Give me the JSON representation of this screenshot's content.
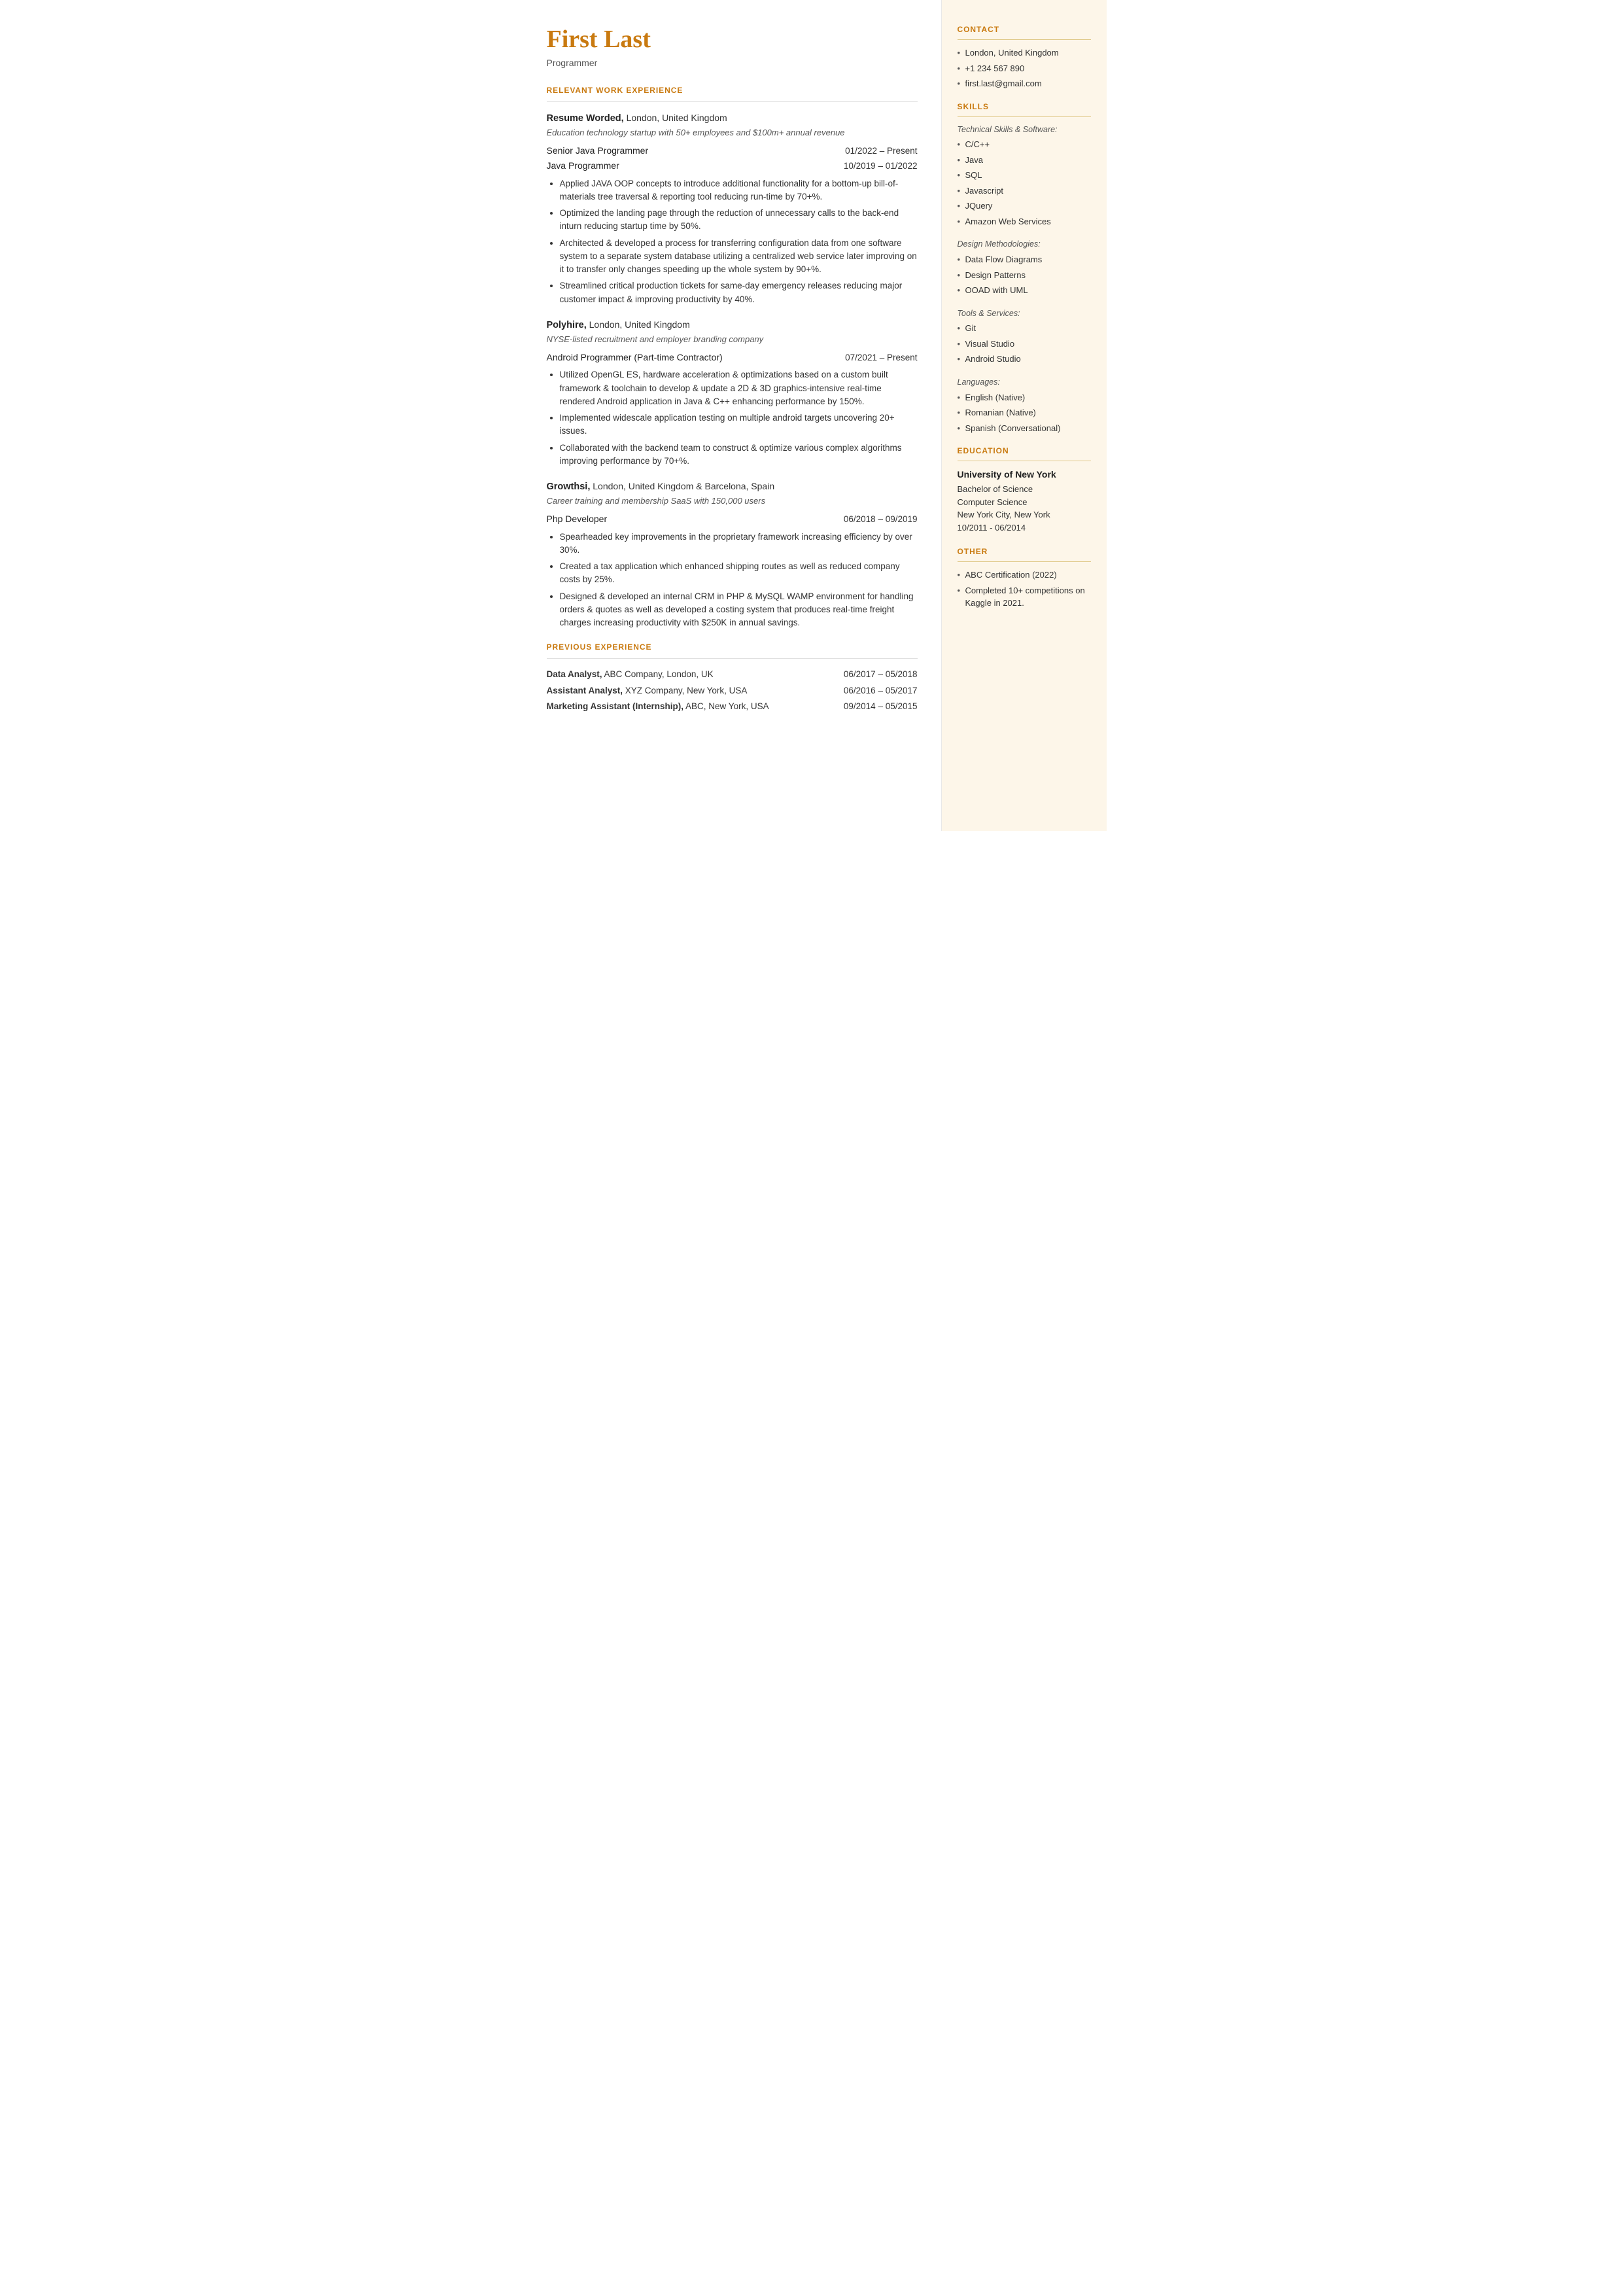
{
  "header": {
    "name": "First Last",
    "title": "Programmer"
  },
  "left": {
    "relevant_work_experience_label": "RELEVANT WORK EXPERIENCE",
    "employers": [
      {
        "name": "Resume Worded,",
        "location": " London, United Kingdom",
        "tagline": "Education technology startup with 50+ employees and $100m+ annual revenue",
        "jobs": [
          {
            "title": "Senior Java Programmer",
            "date": "01/2022 – Present"
          },
          {
            "title": "Java Programmer",
            "date": "10/2019 – 01/2022"
          }
        ],
        "bullets": [
          "Applied JAVA OOP concepts to introduce additional functionality for a bottom-up bill-of-materials tree traversal & reporting tool reducing run-time by 70+%.",
          "Optimized the landing page through the reduction of unnecessary calls to the back-end inturn reducing startup time by 50%.",
          "Architected & developed a process for transferring configuration data from one software system to a separate system database utilizing a centralized web service later improving on it to transfer only changes speeding up the whole system by 90+%.",
          "Streamlined critical production tickets for same-day emergency releases reducing major customer impact & improving productivity by 40%."
        ]
      },
      {
        "name": "Polyhire,",
        "location": " London, United Kingdom",
        "tagline": "NYSE-listed recruitment and employer branding company",
        "jobs": [
          {
            "title": "Android Programmer (Part-time Contractor)",
            "date": "07/2021 – Present"
          }
        ],
        "bullets": [
          "Utilized OpenGL ES, hardware acceleration & optimizations based on a custom built framework & toolchain to develop & update a 2D & 3D graphics-intensive real-time rendered Android application in Java & C++ enhancing performance by 150%.",
          "Implemented widescale application testing on multiple android targets uncovering 20+ issues.",
          "Collaborated with the backend team to construct & optimize various complex algorithms improving performance by 70+%."
        ]
      },
      {
        "name": "Growthsi,",
        "location": " London, United Kingdom & Barcelona, Spain",
        "tagline": "Career training and membership SaaS with 150,000 users",
        "jobs": [
          {
            "title": "Php Developer",
            "date": "06/2018 – 09/2019"
          }
        ],
        "bullets": [
          "Spearheaded key improvements in the proprietary framework increasing efficiency by over 30%.",
          "Created a tax application which enhanced shipping routes as well as reduced company costs by 25%.",
          "Designed & developed an internal CRM in PHP & MySQL WAMP environment for handling orders & quotes as well as developed a costing system that produces real-time freight charges increasing productivity with $250K in annual savings."
        ]
      }
    ],
    "previous_experience_label": "PREVIOUS EXPERIENCE",
    "previous_jobs": [
      {
        "role": "Data Analyst,",
        "company": " ABC Company, London, UK",
        "date": "06/2017 – 05/2018"
      },
      {
        "role": "Assistant Analyst,",
        "company": " XYZ Company, New York, USA",
        "date": "06/2016 – 05/2017"
      },
      {
        "role": "Marketing Assistant (Internship),",
        "company": " ABC, New York, USA",
        "date": "09/2014 – 05/2015"
      }
    ]
  },
  "right": {
    "contact_label": "CONTACT",
    "contact_items": [
      "London, United Kingdom",
      "+1 234 567 890",
      "first.last@gmail.com"
    ],
    "skills_label": "SKILLS",
    "technical_label": "Technical Skills & Software:",
    "technical_items": [
      "C/C++",
      "Java",
      "SQL",
      "Javascript",
      "JQuery",
      "Amazon Web Services"
    ],
    "design_label": "Design Methodologies:",
    "design_items": [
      "Data Flow Diagrams",
      "Design Patterns",
      "OOAD with UML"
    ],
    "tools_label": "Tools & Services:",
    "tools_items": [
      "Git",
      "Visual Studio",
      "Android Studio"
    ],
    "languages_label": "Languages:",
    "languages_items": [
      "English (Native)",
      "Romanian (Native)",
      "Spanish (Conversational)"
    ],
    "education_label": "EDUCATION",
    "education": {
      "university": "University of New York",
      "degree": "Bachelor of Science",
      "field": "Computer Science",
      "location": "New York City, New York",
      "dates": "10/2011 - 06/2014"
    },
    "other_label": "OTHER",
    "other_items": [
      "ABC Certification (2022)",
      "Completed 10+ competitions on Kaggle in 2021."
    ]
  }
}
